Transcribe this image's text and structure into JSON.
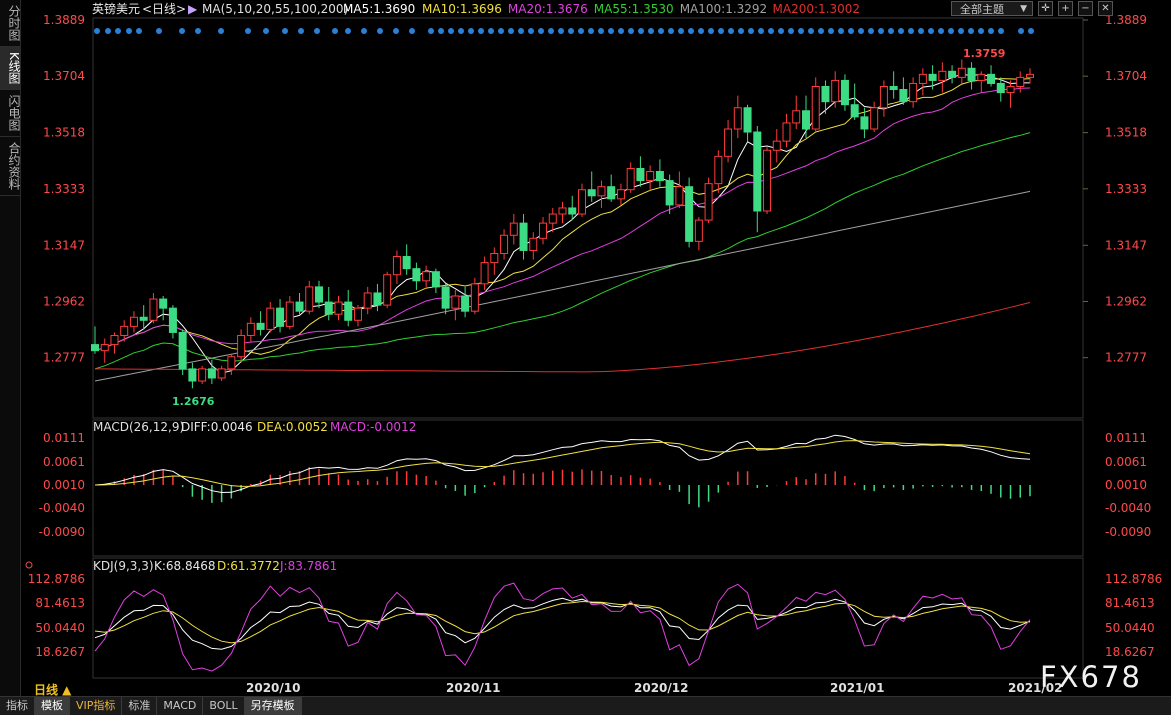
{
  "sidebar": {
    "tabs": [
      {
        "label": "分时图",
        "active": false
      },
      {
        "label": "K线图",
        "active": true
      },
      {
        "label": "闪电图",
        "active": false
      },
      {
        "label": "合约资料",
        "active": false
      }
    ]
  },
  "header": {
    "symbol": "英镑美元",
    "period": "<日线>",
    "ma_params": "MA(5,10,20,55,100,200)",
    "ma_values": [
      {
        "label": "MA5:1.3690",
        "color": "#ffffff"
      },
      {
        "label": "MA10:1.3696",
        "color": "#f0e040"
      },
      {
        "label": "MA20:1.3676",
        "color": "#e040e0"
      },
      {
        "label": "MA55:1.3530",
        "color": "#30d030"
      },
      {
        "label": "MA100:1.3292",
        "color": "#a0a0a0"
      },
      {
        "label": "MA200:1.3002",
        "color": "#e03030"
      }
    ],
    "theme_select": "全部主题",
    "tool_icons": [
      "crosshair-icon",
      "zoom-in-icon",
      "zoom-out-icon",
      "close-icon"
    ]
  },
  "price_axis": {
    "labels": [
      "1.3889",
      "1.3704",
      "1.3518",
      "1.3333",
      "1.3147",
      "1.2962",
      "1.2777"
    ]
  },
  "annotations": {
    "high": "1.3759",
    "low": "1.2676"
  },
  "macd": {
    "title": "MACD(26,12,9)",
    "diff": "DIFF:0.0046",
    "dea": "DEA:0.0052",
    "macd": "MACD:-0.0012",
    "axis_labels": [
      "0.0111",
      "0.0061",
      "0.0010",
      "-0.0040",
      "-0.0090"
    ]
  },
  "kdj": {
    "title": "KDJ(9,3,3)",
    "k": "K:68.8468",
    "d": "D:61.3772",
    "j": "J:83.7861",
    "axis_labels": [
      "112.8786",
      "81.4613",
      "50.0440",
      "18.6267"
    ]
  },
  "time_axis": {
    "period_button": "日线 ▲",
    "labels": [
      "2020/10",
      "2020/11",
      "2020/12",
      "2021/01",
      "2021/02"
    ]
  },
  "bottom_tabs": [
    {
      "label": "指标",
      "active": false,
      "vip": false
    },
    {
      "label": "模板",
      "active": true,
      "vip": false
    },
    {
      "label": "VIP指标",
      "active": false,
      "vip": true
    },
    {
      "label": "标准",
      "active": false,
      "vip": false
    },
    {
      "label": "MACD",
      "active": false,
      "vip": false
    },
    {
      "label": "BOLL",
      "active": false,
      "vip": false
    },
    {
      "label": "另存模板",
      "active": true,
      "vip": false
    }
  ],
  "watermark": "FX678",
  "colors": {
    "up": "#ff3b3b",
    "down": "#3ddc84",
    "axis_text": "#ff4a4a",
    "grid": "#2a2a2a",
    "event_dot": "#2a7fd6"
  },
  "chart_data": {
    "type": "candlestick",
    "title": "英镑美元 日线",
    "price_range": [
      1.2677,
      1.3889
    ],
    "candles": [
      [
        1.282,
        1.288,
        1.279,
        1.28
      ],
      [
        1.28,
        1.284,
        1.276,
        1.282
      ],
      [
        1.282,
        1.286,
        1.279,
        1.285
      ],
      [
        1.285,
        1.29,
        1.283,
        1.288
      ],
      [
        1.288,
        1.293,
        1.286,
        1.291
      ],
      [
        1.291,
        1.295,
        1.287,
        1.29
      ],
      [
        1.29,
        1.299,
        1.289,
        1.297
      ],
      [
        1.297,
        1.298,
        1.29,
        1.294
      ],
      [
        1.294,
        1.295,
        1.284,
        1.286
      ],
      [
        1.286,
        1.287,
        1.272,
        1.274
      ],
      [
        1.274,
        1.276,
        1.2676,
        1.27
      ],
      [
        1.27,
        1.275,
        1.269,
        1.274
      ],
      [
        1.274,
        1.277,
        1.269,
        1.271
      ],
      [
        1.271,
        1.275,
        1.27,
        1.274
      ],
      [
        1.274,
        1.279,
        1.272,
        1.278
      ],
      [
        1.278,
        1.287,
        1.276,
        1.285
      ],
      [
        1.285,
        1.291,
        1.283,
        1.289
      ],
      [
        1.289,
        1.293,
        1.285,
        1.287
      ],
      [
        1.287,
        1.296,
        1.286,
        1.294
      ],
      [
        1.294,
        1.297,
        1.286,
        1.288
      ],
      [
        1.288,
        1.298,
        1.287,
        1.296
      ],
      [
        1.296,
        1.299,
        1.292,
        1.293
      ],
      [
        1.293,
        1.303,
        1.292,
        1.301
      ],
      [
        1.301,
        1.303,
        1.294,
        1.296
      ],
      [
        1.296,
        1.301,
        1.29,
        1.292
      ],
      [
        1.292,
        1.298,
        1.29,
        1.296
      ],
      [
        1.296,
        1.3,
        1.288,
        1.29
      ],
      [
        1.29,
        1.295,
        1.288,
        1.294
      ],
      [
        1.294,
        1.301,
        1.292,
        1.299
      ],
      [
        1.299,
        1.302,
        1.293,
        1.295
      ],
      [
        1.295,
        1.306,
        1.294,
        1.305
      ],
      [
        1.305,
        1.313,
        1.302,
        1.311
      ],
      [
        1.311,
        1.315,
        1.305,
        1.307
      ],
      [
        1.307,
        1.309,
        1.3,
        1.303
      ],
      [
        1.303,
        1.308,
        1.301,
        1.306
      ],
      [
        1.306,
        1.307,
        1.299,
        1.301
      ],
      [
        1.301,
        1.302,
        1.292,
        1.294
      ],
      [
        1.294,
        1.3,
        1.29,
        1.298
      ],
      [
        1.298,
        1.301,
        1.291,
        1.293
      ],
      [
        1.293,
        1.304,
        1.292,
        1.302
      ],
      [
        1.302,
        1.311,
        1.3,
        1.309
      ],
      [
        1.309,
        1.314,
        1.305,
        1.312
      ],
      [
        1.312,
        1.32,
        1.31,
        1.318
      ],
      [
        1.318,
        1.325,
        1.315,
        1.322
      ],
      [
        1.322,
        1.325,
        1.31,
        1.313
      ],
      [
        1.313,
        1.319,
        1.31,
        1.317
      ],
      [
        1.317,
        1.324,
        1.315,
        1.322
      ],
      [
        1.322,
        1.327,
        1.319,
        1.325
      ],
      [
        1.325,
        1.329,
        1.322,
        1.327
      ],
      [
        1.327,
        1.331,
        1.323,
        1.325
      ],
      [
        1.325,
        1.335,
        1.324,
        1.333
      ],
      [
        1.333,
        1.339,
        1.329,
        1.331
      ],
      [
        1.331,
        1.336,
        1.327,
        1.334
      ],
      [
        1.334,
        1.338,
        1.329,
        1.33
      ],
      [
        1.33,
        1.335,
        1.328,
        1.333
      ],
      [
        1.333,
        1.342,
        1.332,
        1.34
      ],
      [
        1.34,
        1.344,
        1.334,
        1.336
      ],
      [
        1.336,
        1.341,
        1.333,
        1.339
      ],
      [
        1.339,
        1.343,
        1.334,
        1.336
      ],
      [
        1.336,
        1.338,
        1.325,
        1.328
      ],
      [
        1.328,
        1.339,
        1.327,
        1.334
      ],
      [
        1.334,
        1.337,
        1.314,
        1.316
      ],
      [
        1.316,
        1.324,
        1.313,
        1.323
      ],
      [
        1.323,
        1.337,
        1.322,
        1.335
      ],
      [
        1.335,
        1.346,
        1.332,
        1.344
      ],
      [
        1.344,
        1.356,
        1.342,
        1.353
      ],
      [
        1.353,
        1.364,
        1.35,
        1.36
      ],
      [
        1.36,
        1.361,
        1.349,
        1.352
      ],
      [
        1.352,
        1.354,
        1.319,
        1.326
      ],
      [
        1.326,
        1.347,
        1.325,
        1.346
      ],
      [
        1.346,
        1.353,
        1.342,
        1.349
      ],
      [
        1.349,
        1.358,
        1.347,
        1.355
      ],
      [
        1.355,
        1.364,
        1.353,
        1.359
      ],
      [
        1.359,
        1.364,
        1.35,
        1.353
      ],
      [
        1.353,
        1.37,
        1.352,
        1.367
      ],
      [
        1.367,
        1.369,
        1.358,
        1.362
      ],
      [
        1.362,
        1.372,
        1.36,
        1.369
      ],
      [
        1.369,
        1.371,
        1.359,
        1.361
      ],
      [
        1.361,
        1.368,
        1.356,
        1.357
      ],
      [
        1.357,
        1.36,
        1.35,
        1.353
      ],
      [
        1.353,
        1.362,
        1.352,
        1.36
      ],
      [
        1.36,
        1.369,
        1.357,
        1.367
      ],
      [
        1.367,
        1.372,
        1.363,
        1.366
      ],
      [
        1.366,
        1.37,
        1.361,
        1.362
      ],
      [
        1.362,
        1.37,
        1.36,
        1.368
      ],
      [
        1.368,
        1.373,
        1.364,
        1.371
      ],
      [
        1.371,
        1.374,
        1.366,
        1.369
      ],
      [
        1.369,
        1.375,
        1.365,
        1.372
      ],
      [
        1.372,
        1.374,
        1.368,
        1.37
      ],
      [
        1.37,
        1.3759,
        1.368,
        1.373
      ],
      [
        1.373,
        1.375,
        1.366,
        1.369
      ],
      [
        1.369,
        1.372,
        1.365,
        1.371
      ],
      [
        1.371,
        1.374,
        1.367,
        1.368
      ],
      [
        1.368,
        1.37,
        1.362,
        1.365
      ],
      [
        1.365,
        1.369,
        1.36,
        1.367
      ],
      [
        1.367,
        1.372,
        1.365,
        1.37
      ],
      [
        1.37,
        1.373,
        1.368,
        1.371
      ]
    ]
  }
}
